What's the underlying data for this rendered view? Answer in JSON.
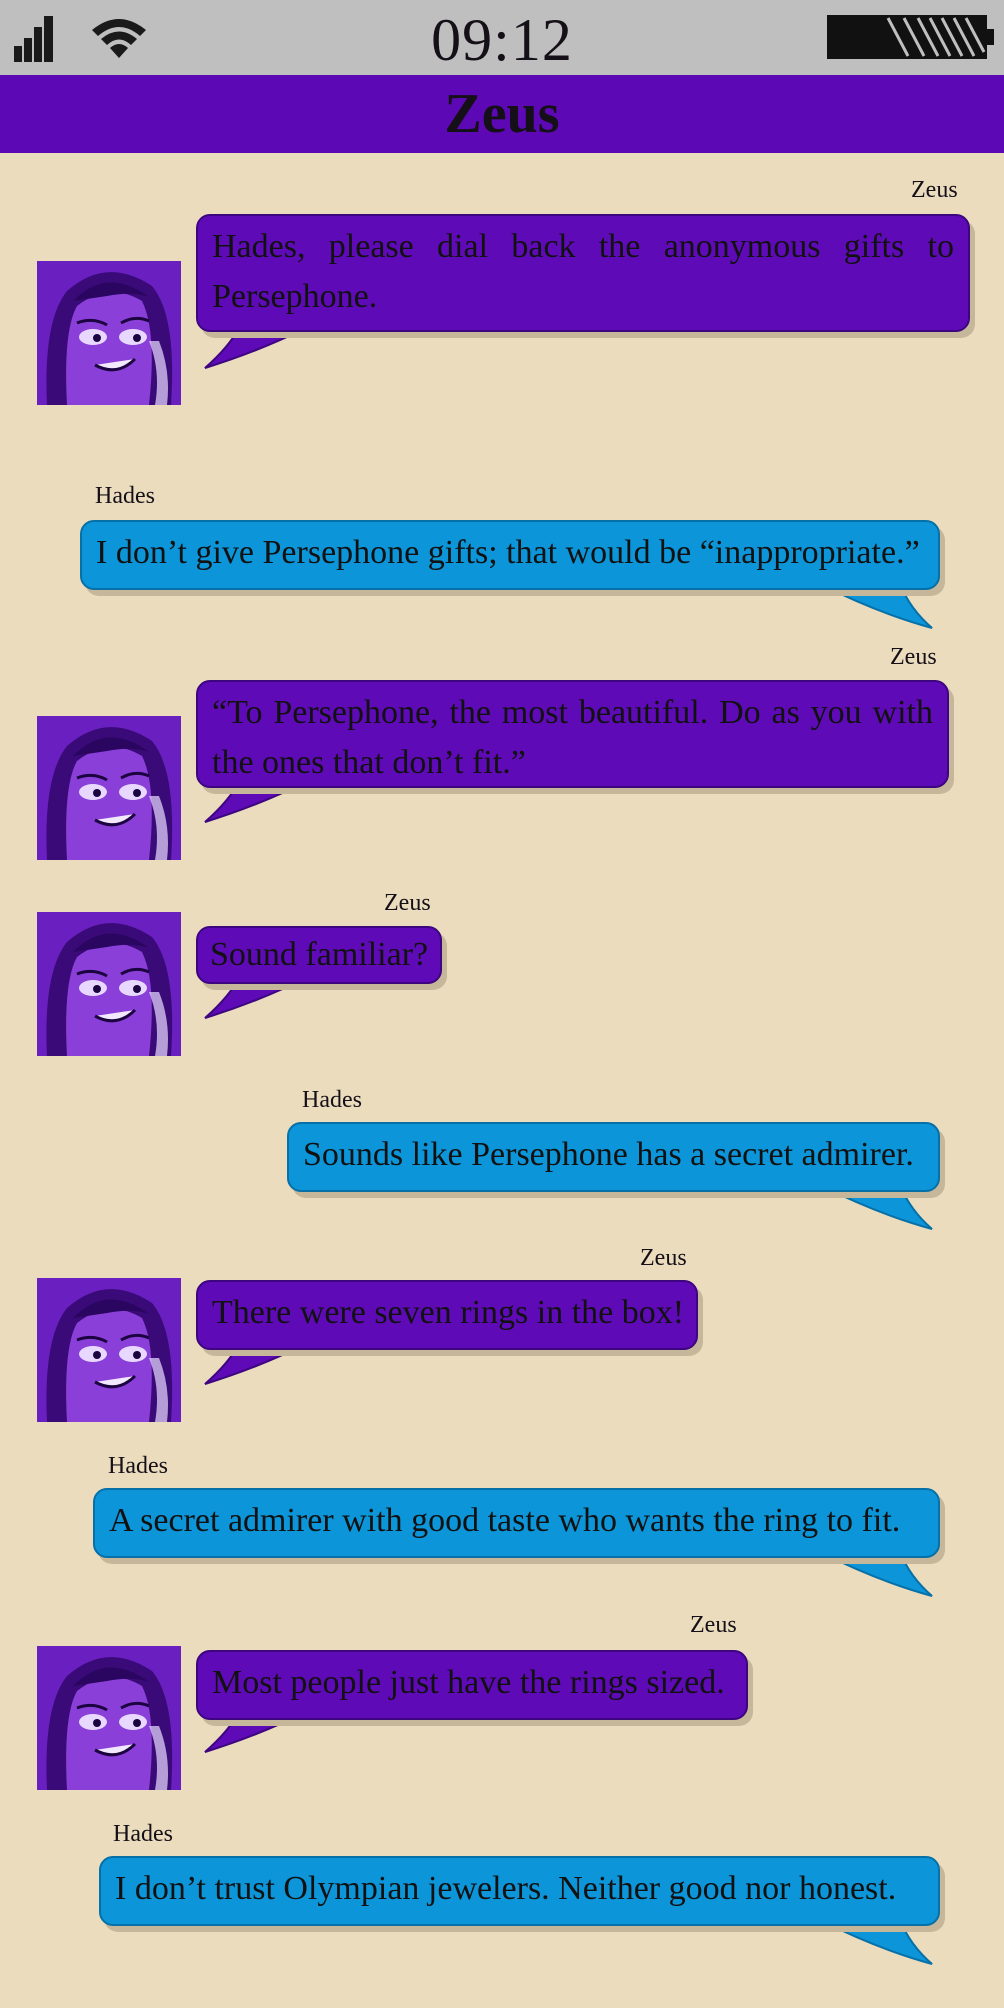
{
  "status": {
    "time": "09:12"
  },
  "header": {
    "title": "Zeus"
  },
  "messages": [
    {
      "sender": "Zeus",
      "text": "Hades, please dial back the anonymous gifts to Persephone."
    },
    {
      "sender": "Hades",
      "text": "I don’t give Persephone gifts; that would be “inappropriate.”"
    },
    {
      "sender": "Zeus",
      "text": "“To Persephone, the most beautiful. Do as you with the ones that don’t fit.”"
    },
    {
      "sender": "Zeus",
      "text": "Sound familiar?"
    },
    {
      "sender": "Hades",
      "text": "Sounds like Persephone has a secret admirer."
    },
    {
      "sender": "Zeus",
      "text": "There were seven rings in the box!"
    },
    {
      "sender": "Hades",
      "text": "A secret admirer with good taste who wants the ring to fit."
    },
    {
      "sender": "Zeus",
      "text": "Most people just have the rings sized."
    },
    {
      "sender": "Hades",
      "text": "I don’t trust Olympian jewelers. Neither good nor honest."
    }
  ],
  "colors": {
    "zeus_bubble": "#5e0ab6",
    "hades_bubble": "#0c95d8",
    "background": "#ebdcbd",
    "header": "#5d08b5"
  },
  "icons": [
    "signal-icon",
    "wifi-icon",
    "battery-icon",
    "zeus-avatar"
  ]
}
